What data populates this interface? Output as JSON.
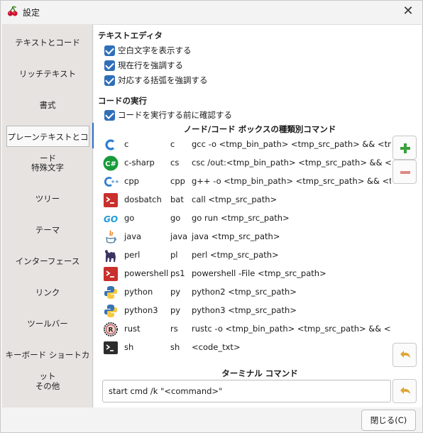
{
  "window": {
    "title": "設定",
    "close_symbol": "✕"
  },
  "sidebar": {
    "items": [
      {
        "label": "テキストとコード",
        "active": false
      },
      {
        "label": "リッチテキスト",
        "active": false
      },
      {
        "label": "書式",
        "active": false
      },
      {
        "label": "プレーンテキストとコード",
        "active": true
      },
      {
        "label": "特殊文字",
        "active": false
      },
      {
        "label": "ツリー",
        "active": false
      },
      {
        "label": "テーマ",
        "active": false
      },
      {
        "label": "インターフェース",
        "active": false
      },
      {
        "label": "リンク",
        "active": false
      },
      {
        "label": "ツールバー",
        "active": false
      },
      {
        "label": "キーボード ショートカット",
        "active": false
      },
      {
        "label": "その他",
        "active": false
      }
    ]
  },
  "text_editor": {
    "title": "テキストエディタ",
    "options": [
      {
        "label": "空白文字を表示する",
        "checked": true
      },
      {
        "label": "現在行を強調する",
        "checked": true
      },
      {
        "label": "対応する括弧を強調する",
        "checked": true
      }
    ]
  },
  "code_exec": {
    "title": "コードの実行",
    "confirm_label": "コードを実行する前に確認する",
    "table_title": "ノード/コード ボックスの種類別コマンド",
    "rows": [
      {
        "name": "c",
        "ext": "c",
        "cmd": "gcc -o <tmp_bin_path> <tmp_src_path> && <tmp_bin_path>",
        "icon": "c-icon"
      },
      {
        "name": "c-sharp",
        "ext": "cs",
        "cmd": "csc /out:<tmp_bin_path> <tmp_src_path> && <tmp_bin_path>",
        "icon": "csharp-icon"
      },
      {
        "name": "cpp",
        "ext": "cpp",
        "cmd": "g++ -o <tmp_bin_path> <tmp_src_path> && <tmp_bin_path>",
        "icon": "cpp-icon"
      },
      {
        "name": "dosbatch",
        "ext": "bat",
        "cmd": "call <tmp_src_path>",
        "icon": "dosbatch-icon"
      },
      {
        "name": "go",
        "ext": "go",
        "cmd": "go run <tmp_src_path>",
        "icon": "go-icon"
      },
      {
        "name": "java",
        "ext": "java",
        "cmd": "java <tmp_src_path>",
        "icon": "java-icon"
      },
      {
        "name": "perl",
        "ext": "pl",
        "cmd": "perl <tmp_src_path>",
        "icon": "perl-icon"
      },
      {
        "name": "powershell",
        "ext": "ps1",
        "cmd": "powershell -File <tmp_src_path>",
        "icon": "powershell-icon"
      },
      {
        "name": "python",
        "ext": "py",
        "cmd": "python2 <tmp_src_path>",
        "icon": "python-icon"
      },
      {
        "name": "python3",
        "ext": "py",
        "cmd": "python3 <tmp_src_path>",
        "icon": "python-icon"
      },
      {
        "name": "rust",
        "ext": "rs",
        "cmd": "rustc -o <tmp_bin_path> <tmp_src_path> && <tmp_bin_path>",
        "icon": "rust-icon"
      },
      {
        "name": "sh",
        "ext": "sh",
        "cmd": "<code_txt>",
        "icon": "terminal-icon"
      }
    ],
    "terminal_title": "ターミナル コマンド",
    "terminal_value": "start cmd /k \"<command>\""
  },
  "footer": {
    "close_label": "閉じる(C)"
  },
  "colors": {
    "accent": "#2a6fc4",
    "checkbox": "#2f6fb8",
    "add_green": "#3aa13a",
    "remove_red": "#d9534f"
  }
}
